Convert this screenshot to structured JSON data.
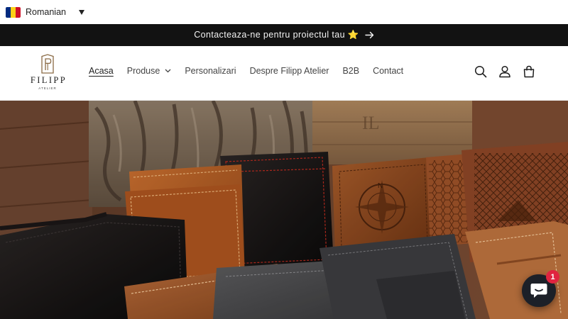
{
  "language": {
    "label": "Romanian",
    "flag_colors": [
      "#002B7F",
      "#FCD116",
      "#CE1126"
    ],
    "icon": "chevron-down-icon"
  },
  "announcement": {
    "text": "Contacteaza-ne pentru proiectul tau ⭐",
    "icon": "arrow-right-icon"
  },
  "brand": {
    "name": "FILIPP",
    "subtitle": "ATELIER"
  },
  "nav": {
    "items": [
      {
        "label": "Acasa",
        "active": true
      },
      {
        "label": "Produse",
        "has_dropdown": true
      },
      {
        "label": "Personalizari"
      },
      {
        "label": "Despre Filipp Atelier"
      },
      {
        "label": "B2B"
      },
      {
        "label": "Contact"
      }
    ]
  },
  "header_icons": [
    "search-icon",
    "account-icon",
    "cart-icon"
  ],
  "chat": {
    "badge_count": "1",
    "icon": "chat-bubble-icon"
  },
  "colors": {
    "announcement_bg": "#121212",
    "chat_button": "#1c2028",
    "badge": "#e02440"
  }
}
